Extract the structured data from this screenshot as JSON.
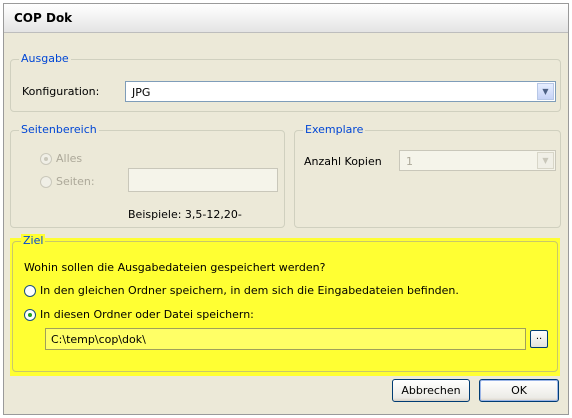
{
  "window": {
    "title": "COP Dok"
  },
  "ausgabe": {
    "legend": "Ausgabe",
    "konfiguration_label": "Konfiguration:",
    "konfiguration_value": "JPG"
  },
  "seitenbereich": {
    "legend": "Seitenbereich",
    "alles_label": "Alles",
    "seiten_label": "Seiten:",
    "seiten_value": "",
    "beispiele": "Beispiele: 3,5-12,20-"
  },
  "exemplare": {
    "legend": "Exemplare",
    "anzahl_label": "Anzahl Kopien",
    "anzahl_value": "1"
  },
  "ziel": {
    "legend": "Ziel",
    "question": "Wohin sollen die Ausgabedateien gespeichert werden?",
    "option_same": "In den gleichen Ordner speichern, in dem sich die Eingabedateien befinden.",
    "option_this": "In diesen Ordner oder Datei speichern:",
    "path": "C:\\temp\\cop\\dok\\",
    "browse_label": ".."
  },
  "buttons": {
    "cancel": "Abbrechen",
    "ok": "OK"
  },
  "colors": {
    "highlight": "#ffff33",
    "legend_text": "#0046d5",
    "dialog_bg": "#ece9d8"
  }
}
